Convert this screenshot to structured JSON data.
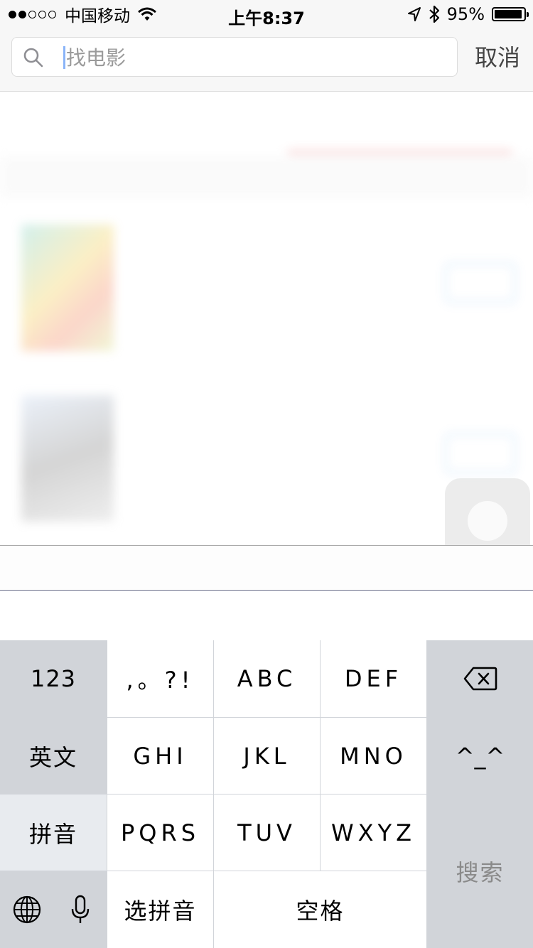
{
  "status_bar": {
    "carrier": "中国移动",
    "time": "上午8:37",
    "battery": "95%",
    "battery_level": 0.95,
    "signal_bars_filled": 2,
    "signal_bars_total": 5
  },
  "search": {
    "placeholder": "找电影",
    "value": "",
    "cancel_label": "取消"
  },
  "background_content": {
    "tabs": [
      "",
      ""
    ],
    "section_header": "",
    "movies": [
      {
        "title": "",
        "score": "",
        "line1": "",
        "line2": "",
        "button": ""
      },
      {
        "title": "",
        "score": "",
        "line1": "",
        "line2": "",
        "button": ""
      }
    ]
  },
  "keyboard": {
    "rows": [
      [
        "123",
        ",。?!",
        "ABC",
        "DEF",
        "delete"
      ],
      [
        "英文",
        "GHI",
        "JKL",
        "MNO",
        "^_^"
      ],
      [
        "拼音",
        "PQRS",
        "TUV",
        "WXYZ",
        "搜索"
      ],
      [
        "globe",
        "mic",
        "选拼音",
        "空格"
      ]
    ],
    "num_key": "123",
    "punct_key": ",。?!",
    "abc": "ABC",
    "def": "DEF",
    "english": "英文",
    "ghi": "GHI",
    "jkl": "JKL",
    "mno": "MNO",
    "emoticon": "^_^",
    "pinyin": "拼音",
    "pqrs": "PQRS",
    "tuv": "TUV",
    "wxyz": "WXYZ",
    "search_key": "搜索",
    "select_pinyin": "选拼音",
    "space": "空格"
  },
  "colors": {
    "accent_red": "#e04d4d",
    "link_blue": "#5aa5f0",
    "keyboard_gray": "#d1d4d9",
    "caret_blue": "#8ab4f8"
  },
  "icons": [
    "search-icon",
    "wifi-icon",
    "location-icon",
    "bluetooth-icon",
    "battery-icon",
    "backspace-icon",
    "globe-icon",
    "microphone-icon"
  ]
}
